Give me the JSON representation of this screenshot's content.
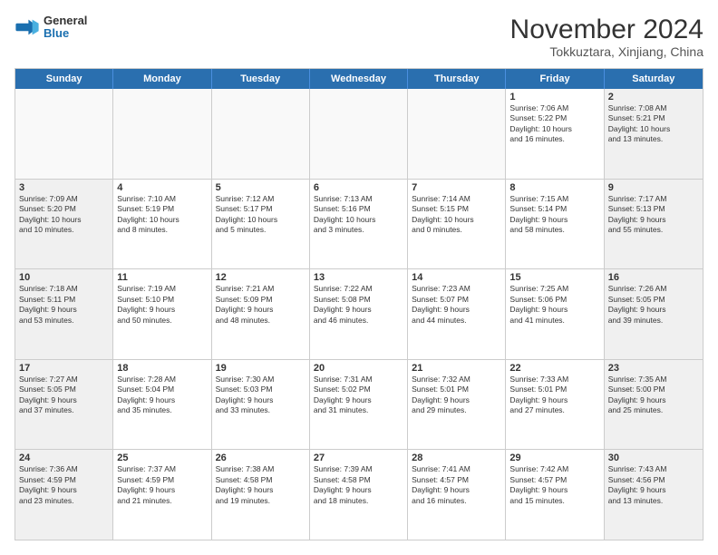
{
  "logo": {
    "line1": "General",
    "line2": "Blue"
  },
  "title": "November 2024",
  "subtitle": "Tokkuztara, Xinjiang, China",
  "weekdays": [
    "Sunday",
    "Monday",
    "Tuesday",
    "Wednesday",
    "Thursday",
    "Friday",
    "Saturday"
  ],
  "rows": [
    [
      {
        "day": "",
        "info": "",
        "empty": true
      },
      {
        "day": "",
        "info": "",
        "empty": true
      },
      {
        "day": "",
        "info": "",
        "empty": true
      },
      {
        "day": "",
        "info": "",
        "empty": true
      },
      {
        "day": "",
        "info": "",
        "empty": true
      },
      {
        "day": "1",
        "info": "Sunrise: 7:06 AM\nSunset: 5:22 PM\nDaylight: 10 hours\nand 16 minutes.",
        "empty": false
      },
      {
        "day": "2",
        "info": "Sunrise: 7:08 AM\nSunset: 5:21 PM\nDaylight: 10 hours\nand 13 minutes.",
        "empty": false
      }
    ],
    [
      {
        "day": "3",
        "info": "Sunrise: 7:09 AM\nSunset: 5:20 PM\nDaylight: 10 hours\nand 10 minutes.",
        "empty": false
      },
      {
        "day": "4",
        "info": "Sunrise: 7:10 AM\nSunset: 5:19 PM\nDaylight: 10 hours\nand 8 minutes.",
        "empty": false
      },
      {
        "day": "5",
        "info": "Sunrise: 7:12 AM\nSunset: 5:17 PM\nDaylight: 10 hours\nand 5 minutes.",
        "empty": false
      },
      {
        "day": "6",
        "info": "Sunrise: 7:13 AM\nSunset: 5:16 PM\nDaylight: 10 hours\nand 3 minutes.",
        "empty": false
      },
      {
        "day": "7",
        "info": "Sunrise: 7:14 AM\nSunset: 5:15 PM\nDaylight: 10 hours\nand 0 minutes.",
        "empty": false
      },
      {
        "day": "8",
        "info": "Sunrise: 7:15 AM\nSunset: 5:14 PM\nDaylight: 9 hours\nand 58 minutes.",
        "empty": false
      },
      {
        "day": "9",
        "info": "Sunrise: 7:17 AM\nSunset: 5:13 PM\nDaylight: 9 hours\nand 55 minutes.",
        "empty": false
      }
    ],
    [
      {
        "day": "10",
        "info": "Sunrise: 7:18 AM\nSunset: 5:11 PM\nDaylight: 9 hours\nand 53 minutes.",
        "empty": false
      },
      {
        "day": "11",
        "info": "Sunrise: 7:19 AM\nSunset: 5:10 PM\nDaylight: 9 hours\nand 50 minutes.",
        "empty": false
      },
      {
        "day": "12",
        "info": "Sunrise: 7:21 AM\nSunset: 5:09 PM\nDaylight: 9 hours\nand 48 minutes.",
        "empty": false
      },
      {
        "day": "13",
        "info": "Sunrise: 7:22 AM\nSunset: 5:08 PM\nDaylight: 9 hours\nand 46 minutes.",
        "empty": false
      },
      {
        "day": "14",
        "info": "Sunrise: 7:23 AM\nSunset: 5:07 PM\nDaylight: 9 hours\nand 44 minutes.",
        "empty": false
      },
      {
        "day": "15",
        "info": "Sunrise: 7:25 AM\nSunset: 5:06 PM\nDaylight: 9 hours\nand 41 minutes.",
        "empty": false
      },
      {
        "day": "16",
        "info": "Sunrise: 7:26 AM\nSunset: 5:05 PM\nDaylight: 9 hours\nand 39 minutes.",
        "empty": false
      }
    ],
    [
      {
        "day": "17",
        "info": "Sunrise: 7:27 AM\nSunset: 5:05 PM\nDaylight: 9 hours\nand 37 minutes.",
        "empty": false
      },
      {
        "day": "18",
        "info": "Sunrise: 7:28 AM\nSunset: 5:04 PM\nDaylight: 9 hours\nand 35 minutes.",
        "empty": false
      },
      {
        "day": "19",
        "info": "Sunrise: 7:30 AM\nSunset: 5:03 PM\nDaylight: 9 hours\nand 33 minutes.",
        "empty": false
      },
      {
        "day": "20",
        "info": "Sunrise: 7:31 AM\nSunset: 5:02 PM\nDaylight: 9 hours\nand 31 minutes.",
        "empty": false
      },
      {
        "day": "21",
        "info": "Sunrise: 7:32 AM\nSunset: 5:01 PM\nDaylight: 9 hours\nand 29 minutes.",
        "empty": false
      },
      {
        "day": "22",
        "info": "Sunrise: 7:33 AM\nSunset: 5:01 PM\nDaylight: 9 hours\nand 27 minutes.",
        "empty": false
      },
      {
        "day": "23",
        "info": "Sunrise: 7:35 AM\nSunset: 5:00 PM\nDaylight: 9 hours\nand 25 minutes.",
        "empty": false
      }
    ],
    [
      {
        "day": "24",
        "info": "Sunrise: 7:36 AM\nSunset: 4:59 PM\nDaylight: 9 hours\nand 23 minutes.",
        "empty": false
      },
      {
        "day": "25",
        "info": "Sunrise: 7:37 AM\nSunset: 4:59 PM\nDaylight: 9 hours\nand 21 minutes.",
        "empty": false
      },
      {
        "day": "26",
        "info": "Sunrise: 7:38 AM\nSunset: 4:58 PM\nDaylight: 9 hours\nand 19 minutes.",
        "empty": false
      },
      {
        "day": "27",
        "info": "Sunrise: 7:39 AM\nSunset: 4:58 PM\nDaylight: 9 hours\nand 18 minutes.",
        "empty": false
      },
      {
        "day": "28",
        "info": "Sunrise: 7:41 AM\nSunset: 4:57 PM\nDaylight: 9 hours\nand 16 minutes.",
        "empty": false
      },
      {
        "day": "29",
        "info": "Sunrise: 7:42 AM\nSunset: 4:57 PM\nDaylight: 9 hours\nand 15 minutes.",
        "empty": false
      },
      {
        "day": "30",
        "info": "Sunrise: 7:43 AM\nSunset: 4:56 PM\nDaylight: 9 hours\nand 13 minutes.",
        "empty": false
      }
    ]
  ]
}
